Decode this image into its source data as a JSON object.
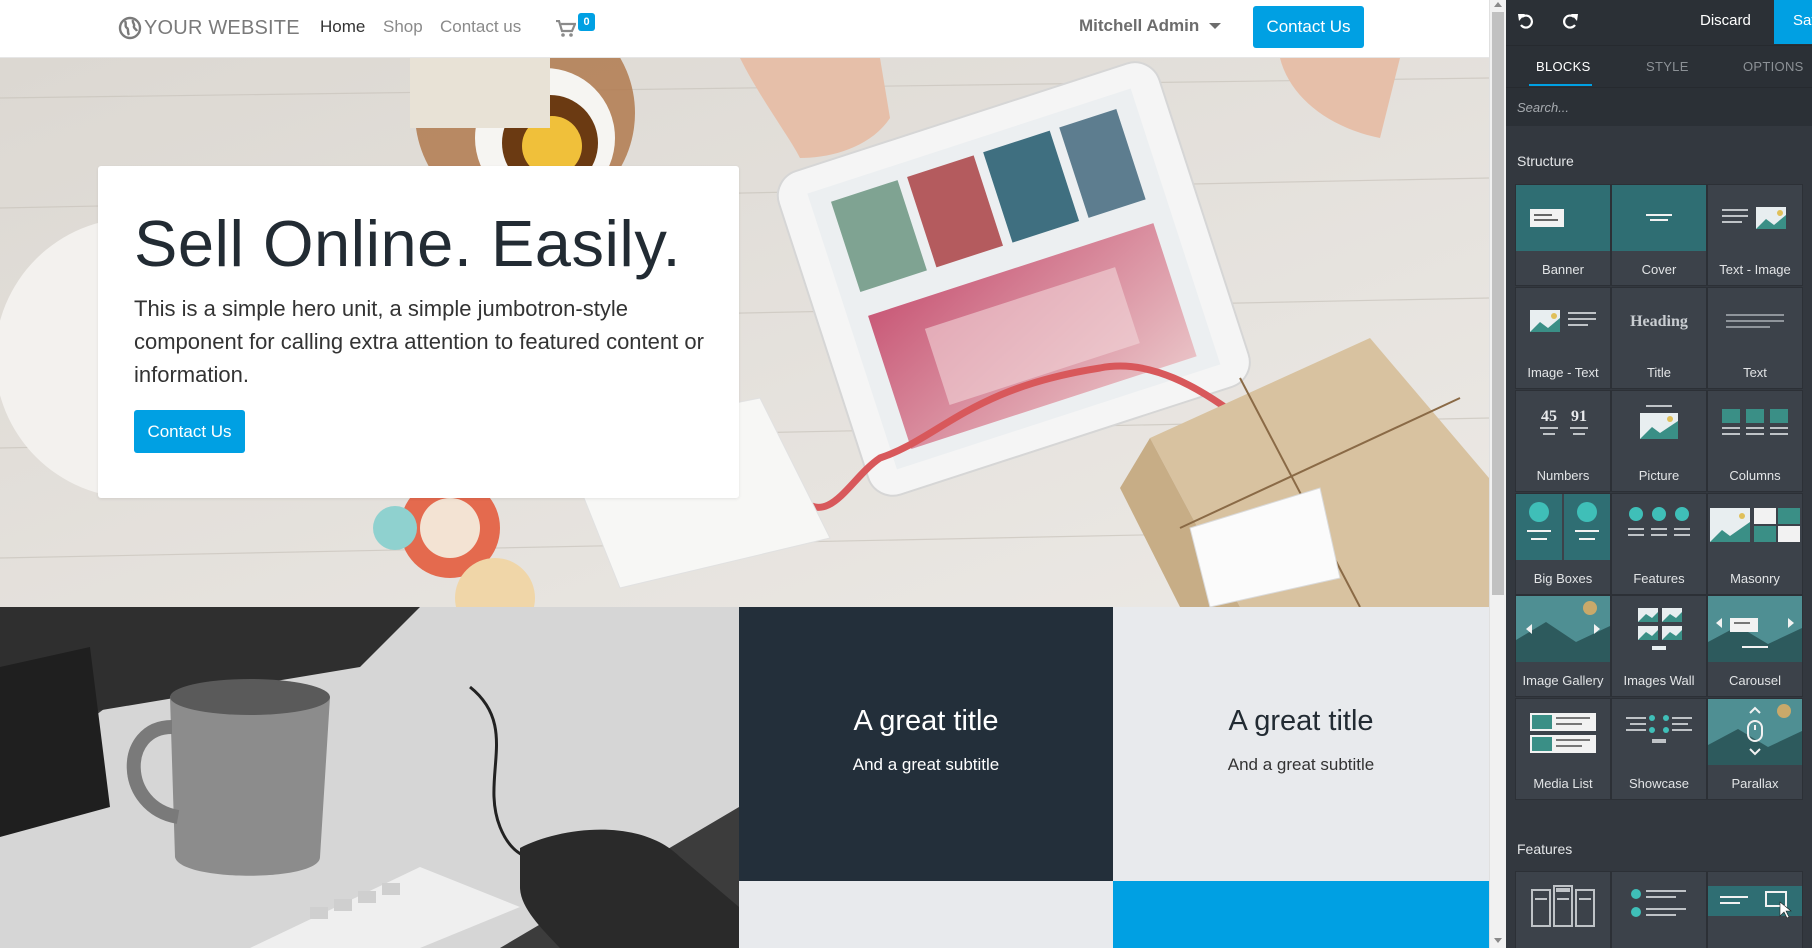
{
  "site": {
    "nav": {
      "brand": "YOUR WEBSITE",
      "links": [
        "Home",
        "Shop",
        "Contact us"
      ],
      "cart_count": "0",
      "user": "Mitchell Admin",
      "cta": "Contact Us"
    },
    "hero": {
      "title": "Sell Online. Easily.",
      "text": "This is a simple hero unit, a simple jumbotron-style component for calling extra attention to featured content or information.",
      "button": "Contact Us"
    },
    "tiles": [
      {
        "title": "A great title",
        "subtitle": "And a great subtitle"
      },
      {
        "title": "A great title",
        "subtitle": "And a great subtitle"
      }
    ]
  },
  "editor": {
    "discard": "Discard",
    "save": "Save",
    "tabs": [
      "BLOCKS",
      "STYLE",
      "OPTIONS"
    ],
    "search_placeholder": "Search...",
    "sections": {
      "structure": "Structure",
      "features": "Features"
    },
    "blocks": [
      "Banner",
      "Cover",
      "Text - Image",
      "Image - Text",
      "Title",
      "Text",
      "Numbers",
      "Picture",
      "Columns",
      "Big Boxes",
      "Features",
      "Masonry",
      "Image Gallery",
      "Images Wall",
      "Carousel",
      "Media List",
      "Showcase",
      "Parallax"
    ],
    "thumb_text": {
      "heading": "Heading",
      "num_a": "45",
      "num_b": "91"
    }
  },
  "colors": {
    "primary": "#00a0e3",
    "editor_bg": "#33383f",
    "dark_tile": "#232f3a",
    "light_tile": "#e8eaed",
    "teal": "#23848f"
  }
}
